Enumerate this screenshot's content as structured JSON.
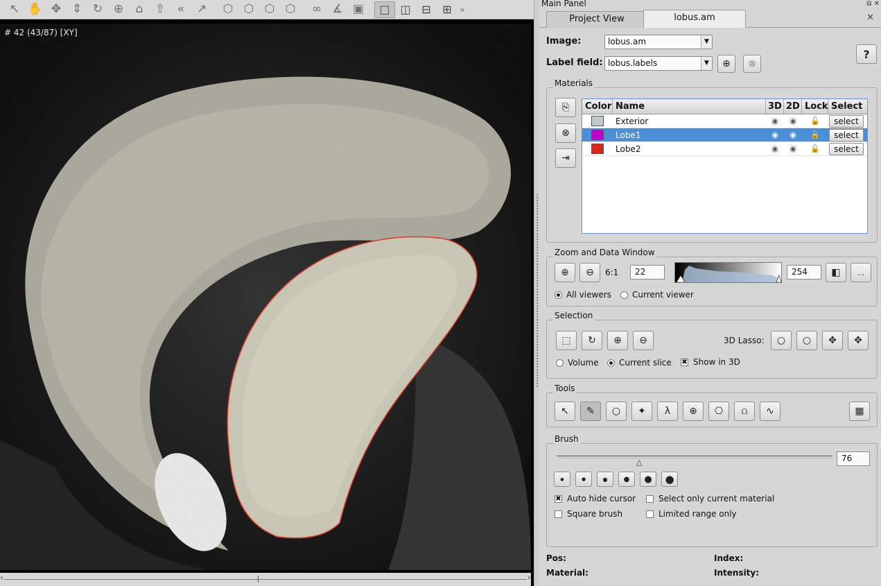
{
  "toolbar": {
    "icons": [
      "pointer-icon",
      "hand-icon",
      "move-icon",
      "translate-icon",
      "rotate-icon",
      "crosshair-icon",
      "home-icon",
      "set-home-icon",
      "back-icon",
      "pick-icon",
      "view-x-icon",
      "view-y-icon",
      "view-z-icon",
      "view-xyz-icon",
      "stereo-icon",
      "measure-icon",
      "snapshot-icon"
    ],
    "layout_buttons": [
      "single-view",
      "two-columns",
      "two-rows",
      "four-views"
    ],
    "overflow_label": "»"
  },
  "viewer": {
    "slice_label": "# 42 (43/87) [XY]"
  },
  "panel": {
    "title": "Main Panel",
    "tabs": [
      "Project View",
      "lobus.am"
    ],
    "active_tab": 1,
    "image_label": "Image:",
    "image_value": "lobus.am",
    "label_field_label": "Label field:",
    "label_field_value": "lobus.labels",
    "help_label": "?"
  },
  "materials": {
    "title": "Materials",
    "columns": [
      "Color",
      "Name",
      "3D",
      "2D",
      "Lock",
      "Select"
    ],
    "rows": [
      {
        "name": "Exterior",
        "color": "#c0c8cc",
        "select": "select",
        "selected": false
      },
      {
        "name": "Lobe1",
        "color": "#c000c8",
        "select": "select",
        "selected": true
      },
      {
        "name": "Lobe2",
        "color": "#d8281c",
        "select": "select",
        "selected": false
      }
    ]
  },
  "zoom": {
    "title": "Zoom and Data Window",
    "ratio": "6:1",
    "min_value": "22",
    "max_value": "254",
    "more_label": "...",
    "radio_all": "All viewers",
    "radio_current": "Current viewer"
  },
  "selection": {
    "title": "Selection",
    "lasso_label": "3D Lasso:",
    "radio_volume": "Volume",
    "radio_slice": "Current slice",
    "check_show3d": "Show in 3D"
  },
  "tools": {
    "title": "Tools"
  },
  "brush": {
    "title": "Brush",
    "size_value": "76",
    "check_autohide": "Auto hide cursor",
    "check_only_current": "Select only current material",
    "check_square": "Square brush",
    "check_limited": "Limited range only"
  },
  "status": {
    "pos_label": "Pos:",
    "index_label": "Index:",
    "material_label": "Material:",
    "intensity_label": "Intensity:"
  },
  "colors": {
    "selection_row": "#4a8fd8",
    "outline": "#e0321e"
  }
}
